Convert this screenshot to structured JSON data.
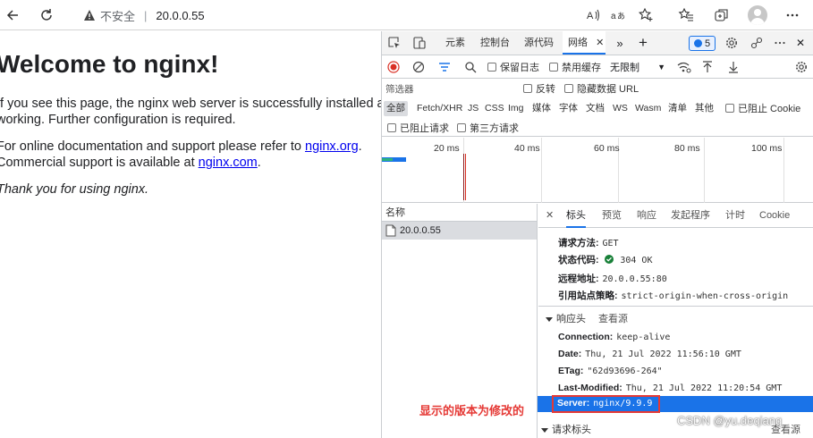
{
  "browser": {
    "security_label": "不安全",
    "address": "20.0.0.55"
  },
  "page": {
    "heading": "Welcome to nginx!",
    "para1_line1": "If you see this page, the nginx web server is successfully installed and",
    "para1_line2": "working. Further configuration is required.",
    "para2_prefix": "For online documentation and support please refer to ",
    "para2_link1": "nginx.org",
    "para2_mid": ".",
    "para2_line2_prefix": "Commercial support is available at ",
    "para2_link2": "nginx.com",
    "para2_suffix": ".",
    "para3": "Thank you for using nginx."
  },
  "devtools": {
    "tabs": [
      "元素",
      "控制台",
      "源代码",
      "网络"
    ],
    "active_tab": "网络",
    "issues_count": "5",
    "network_toolbar": {
      "preserve_log": "保留日志",
      "disable_cache": "禁用缓存",
      "throttle": "无限制"
    },
    "filter": {
      "placeholder": "筛选器",
      "invert": "反转",
      "hide_data_urls": "隐藏数据 URL"
    },
    "types": [
      "全部",
      "Fetch/XHR",
      "JS",
      "CSS",
      "Img",
      "媒体",
      "字体",
      "文档",
      "WS",
      "Wasm",
      "清单",
      "其他"
    ],
    "blocked_cookies": "已阻止 Cookie",
    "blocked_requests": "已阻止请求",
    "third_party": "第三方请求",
    "timeline_ticks": [
      "20 ms",
      "40 ms",
      "60 ms",
      "80 ms",
      "100 ms"
    ],
    "request_list": {
      "header": "名称",
      "row": "20.0.0.55"
    },
    "detail_tabs": [
      "标头",
      "预览",
      "响应",
      "发起程序",
      "计时",
      "Cookie"
    ],
    "general": {
      "method_k": "请求方法:",
      "method_v": "GET",
      "status_k": "状态代码:",
      "status_v": "304 OK",
      "remote_k": "远程地址:",
      "remote_v": "20.0.0.55:80",
      "referrer_k": "引用站点策略:",
      "referrer_v": "strict-origin-when-cross-origin"
    },
    "response_headers": {
      "title": "响应头",
      "view_source": "查看源",
      "connection_k": "Connection:",
      "connection_v": "keep-alive",
      "date_k": "Date:",
      "date_v": "Thu, 21 Jul 2022 11:56:10 GMT",
      "etag_k": "ETag:",
      "etag_v": "\"62d93696-264\"",
      "lastmod_k": "Last-Modified:",
      "lastmod_v": "Thu, 21 Jul 2022 11:20:54 GMT",
      "server_k": "Server:",
      "server_v": "nginx/9.9.9"
    },
    "request_headers": {
      "title": "请求标头",
      "view_source": "查看源"
    }
  },
  "annotation": "显示的版本为修改的",
  "watermark": "CSDN @yu.deqiang",
  "colors": {
    "accent": "#1a73e8",
    "annotation": "#e53935",
    "record": "#d93025",
    "status_ok": "#188038"
  }
}
